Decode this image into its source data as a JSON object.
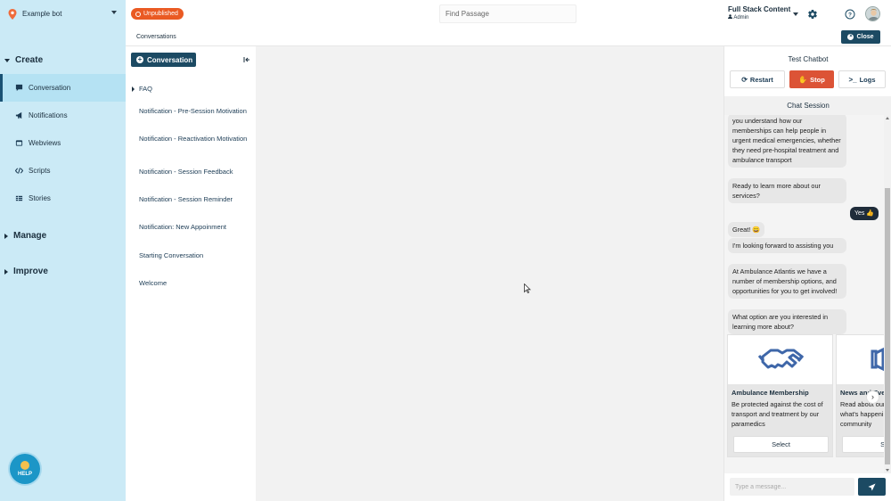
{
  "topbar": {
    "bot_name": "Example bot",
    "status": "Unpublished",
    "search_placeholder": "Find Passage",
    "account_name": "Full Stack Content",
    "account_role": "Admin"
  },
  "sidebar": {
    "sections": [
      {
        "label": "Create",
        "expanded": true
      },
      {
        "label": "Manage",
        "expanded": false
      },
      {
        "label": "Improve",
        "expanded": false
      }
    ],
    "items": [
      {
        "label": "Conversation",
        "icon": "chat-icon",
        "active": true
      },
      {
        "label": "Notifications",
        "icon": "megaphone-icon",
        "active": false
      },
      {
        "label": "Webviews",
        "icon": "browser-icon",
        "active": false
      },
      {
        "label": "Scripts",
        "icon": "code-icon",
        "active": false
      },
      {
        "label": "Stories",
        "icon": "stories-icon",
        "active": false
      }
    ],
    "help_label": "HELP"
  },
  "breadcrumb": "Conversations",
  "close_label": "Close",
  "conversation_panel": {
    "new_button": "Conversation",
    "items": [
      "FAQ",
      "Notification - Pre-Session Motivation",
      "Notification - Reactivation Motivation",
      "Notification - Session Feedback",
      "Notification - Session Reminder",
      "Notification: New Appoinment",
      "Starting Conversation",
      "Welcome"
    ]
  },
  "chatbot": {
    "title": "Test Chatbot",
    "restart": "Restart",
    "stop": "Stop",
    "logs": "Logs",
    "session_title": "Chat Session",
    "messages": [
      "you understand how our memberships can help people in urgent medical emergencies, whether they need pre-hospital treatment and ambulance transport",
      "Ready to learn more about our services?",
      "Yes 👍",
      "Great! 😀",
      "I'm looking forward to assisting you",
      "At Ambulance Atlantis we have a number of membership options, and opportunities for you to get involved!",
      "What option are you interested in learning more about?"
    ],
    "cards": [
      {
        "title": "Ambulance Membership",
        "desc": "Be protected against the cost of transport and treatment by our paramedics",
        "button": "Select"
      },
      {
        "title": "News and Events",
        "desc": "Read about our latest news and what's happening in the community",
        "button": "Select"
      }
    ],
    "input_placeholder": "Type a message..."
  },
  "colors": {
    "sidebar_bg": "#cbeaf6",
    "primary": "#1c4a63",
    "unpublished": "#ea5a23",
    "stop": "#dc5336"
  }
}
